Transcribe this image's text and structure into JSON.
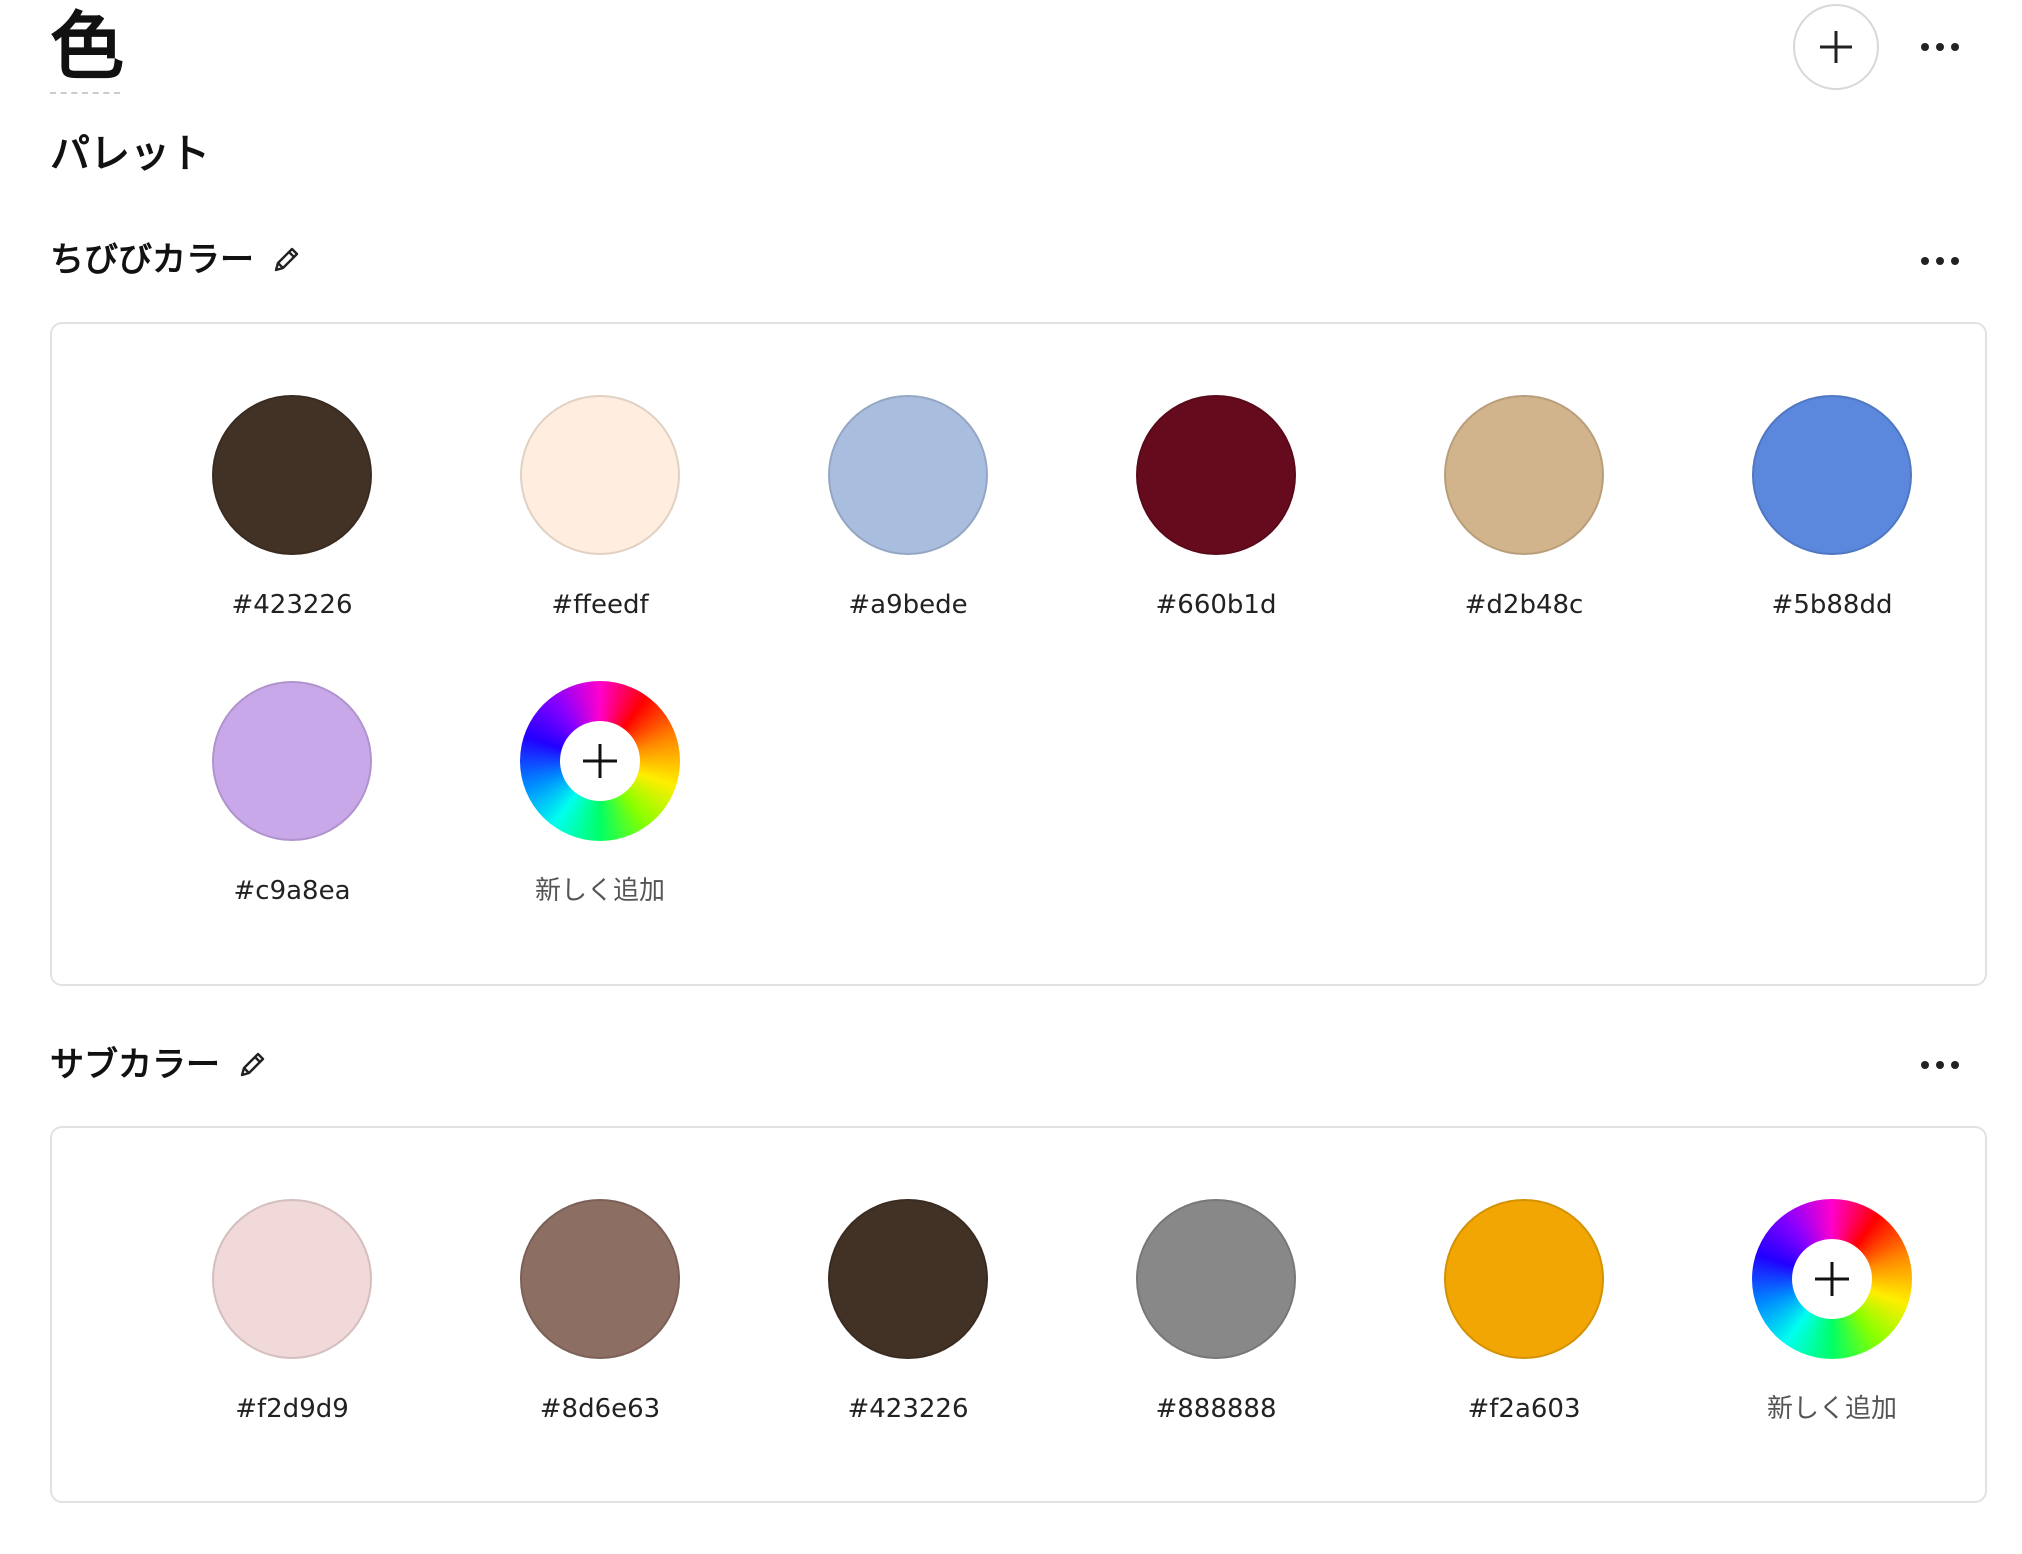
{
  "page": {
    "title": "色",
    "add_icon": "plus-icon",
    "more_icon": "more-horizontal-icon",
    "subtitle": "パレット"
  },
  "palettes": [
    {
      "name": "ちびびカラー",
      "edit_icon": "pencil-icon",
      "more_icon": "more-horizontal-icon",
      "swatches": [
        {
          "hex": "#423226",
          "color": "#423226"
        },
        {
          "hex": "#ffeedf",
          "color": "#ffeedf"
        },
        {
          "hex": "#a9bede",
          "color": "#a9bede"
        },
        {
          "hex": "#660b1d",
          "color": "#660b1d"
        },
        {
          "hex": "#d2b48c",
          "color": "#d2b48c"
        },
        {
          "hex": "#5b88dd",
          "color": "#5b88dd"
        },
        {
          "hex": "#c9a8ea",
          "color": "#c9a8ea"
        }
      ],
      "add_label": "新しく追加"
    },
    {
      "name": "サブカラー",
      "edit_icon": "pencil-icon",
      "more_icon": "more-horizontal-icon",
      "swatches": [
        {
          "hex": "#f2d9d9",
          "color": "#f2d9d9"
        },
        {
          "hex": "#8d6e63",
          "color": "#8d6e63"
        },
        {
          "hex": "#423226",
          "color": "#423226"
        },
        {
          "hex": "#888888",
          "color": "#888888"
        },
        {
          "hex": "#f2a603",
          "color": "#f2a603"
        }
      ],
      "add_label": "新しく追加"
    }
  ]
}
